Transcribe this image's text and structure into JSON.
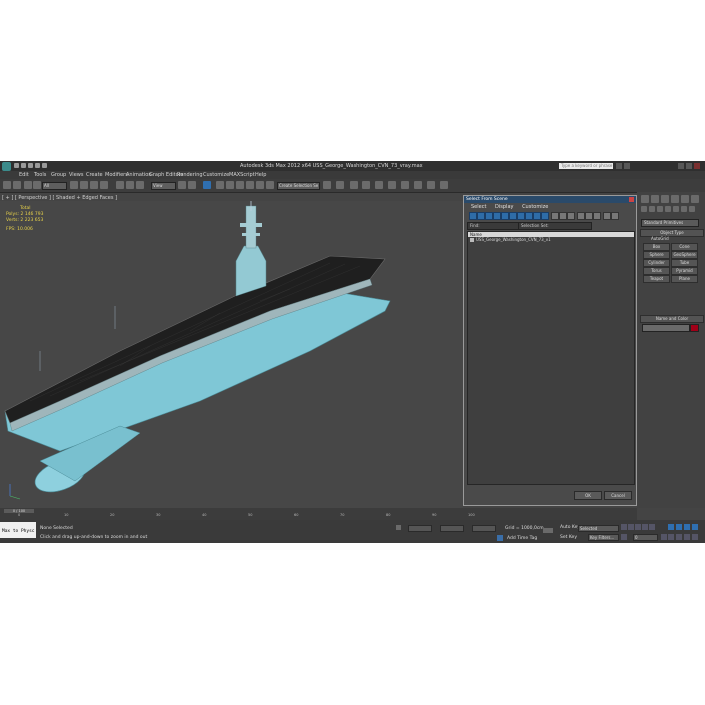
{
  "app": {
    "title": "Autodesk 3ds Max  2012 x64       USS_George_Washington_CVN_73_vray.max",
    "search_placeholder": "Type a keyword or phrase"
  },
  "menu": [
    "Edit",
    "Tools",
    "Group",
    "Views",
    "Create",
    "Modifiers",
    "Animation",
    "Graph Editors",
    "Rendering",
    "Customize",
    "MAXScript",
    "Help"
  ],
  "toolbar": {
    "selection_filter": "All",
    "reference_coord": "View",
    "named_selection_set": "Create Selection Se"
  },
  "viewport": {
    "label": "[ + ] [ Perspective ] [ Shaded + Edged Faces ]",
    "stats": {
      "total_label": "Total",
      "polys_label": "Polys:",
      "polys_value": "2 146 793",
      "verts_label": "Verts:",
      "verts_value": "2 223 653",
      "fps_label": "FPS:",
      "fps_value": "10.006"
    }
  },
  "select_dialog": {
    "title": "Select From Scene",
    "menu": [
      "Select",
      "Display",
      "Customize"
    ],
    "find_label": "Find:",
    "selection_set_label": "Selection Set:",
    "column_name": "Name",
    "objects": [
      "USS_George_Washington_CVN_73_v1"
    ],
    "ok_label": "OK",
    "cancel_label": "Cancel"
  },
  "command_panel": {
    "category": "Standard Primitives",
    "object_type_header": "Object Type",
    "autogrid_label": "AutoGrid",
    "buttons": [
      "Box",
      "Cone",
      "Sphere",
      "GeoSphere",
      "Cylinder",
      "Tube",
      "Torus",
      "Pyramid",
      "Teapot",
      "Plane"
    ],
    "name_color_header": "Name and Color",
    "swatch_color": "#a00018"
  },
  "timeline": {
    "frame_display": "0 / 100",
    "ticks": [
      "0",
      "10",
      "20",
      "30",
      "40",
      "50",
      "60",
      "70",
      "80",
      "90",
      "100"
    ]
  },
  "status": {
    "maxscript_text": "Max to Physc",
    "selection": "None Selected",
    "prompt": "Click and drag up-and-down to zoom in and out",
    "grid": "Grid = 1000,0cm",
    "auto_key": "Auto Key",
    "selected_mode": "Selected",
    "set_key": "Set Key",
    "key_filters": "Key Filters...",
    "add_time_tag": "Add Time Tag",
    "frame_field": "0"
  }
}
